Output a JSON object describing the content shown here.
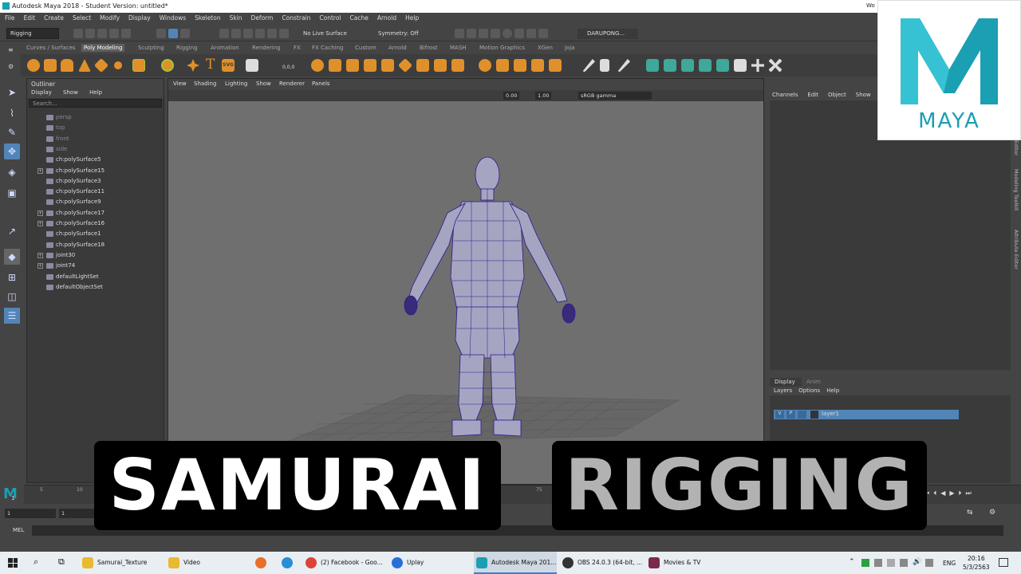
{
  "window": {
    "title": "Autodesk Maya 2018 - Student Version: untitled*",
    "user_short": "Wo"
  },
  "menubar": [
    "File",
    "Edit",
    "Create",
    "Select",
    "Modify",
    "Display",
    "Windows",
    "Skeleton",
    "Skin",
    "Deform",
    "Constrain",
    "Control",
    "Cache",
    "Arnold",
    "Help"
  ],
  "statusline": {
    "menuset": "Rigging",
    "live_surface": "No Live Surface",
    "symmetry": "Symmetry: Off",
    "user": "DARUPONG..."
  },
  "shelf_tabs": [
    "Curves / Surfaces",
    "Poly Modeling",
    "Sculpting",
    "Rigging",
    "Animation",
    "Rendering",
    "FX",
    "FX Caching",
    "Custom",
    "Arnold",
    "Bifrost",
    "MASH",
    "Motion Graphics",
    "XGen",
    "Joja"
  ],
  "shelf_active": "Poly Modeling",
  "shelf_text_icon": "SVG",
  "shelf_extra_label": "0,0,0",
  "outliner": {
    "title": "Outliner",
    "menu": [
      "Display",
      "Show",
      "Help"
    ],
    "search_placeholder": "Search...",
    "items": [
      {
        "label": "persp",
        "dim": true,
        "expand": false
      },
      {
        "label": "top",
        "dim": true,
        "expand": false
      },
      {
        "label": "front",
        "dim": true,
        "expand": false
      },
      {
        "label": "side",
        "dim": true,
        "expand": false
      },
      {
        "label": "ch:polySurface5",
        "dim": false,
        "expand": false
      },
      {
        "label": "ch:polySurface15",
        "dim": false,
        "expand": true
      },
      {
        "label": "ch:polySurface3",
        "dim": false,
        "expand": false
      },
      {
        "label": "ch:polySurface11",
        "dim": false,
        "expand": false
      },
      {
        "label": "ch:polySurface9",
        "dim": false,
        "expand": false
      },
      {
        "label": "ch:polySurface17",
        "dim": false,
        "expand": true
      },
      {
        "label": "ch:polySurface16",
        "dim": false,
        "expand": true
      },
      {
        "label": "ch:polySurface1",
        "dim": false,
        "expand": false
      },
      {
        "label": "ch:polySurface18",
        "dim": false,
        "expand": false
      },
      {
        "label": "joint30",
        "dim": false,
        "expand": true
      },
      {
        "label": "joint74",
        "dim": false,
        "expand": true
      },
      {
        "label": "defaultLightSet",
        "dim": false,
        "expand": false
      },
      {
        "label": "defaultObjectSet",
        "dim": false,
        "expand": false
      }
    ]
  },
  "viewport": {
    "menu": [
      "View",
      "Shading",
      "Lighting",
      "Show",
      "Renderer",
      "Panels"
    ],
    "val1": "0.00",
    "val2": "1.00",
    "colorspace": "sRGB gamma"
  },
  "channelbox": {
    "menu": [
      "Channels",
      "Edit",
      "Object",
      "Show"
    ]
  },
  "layers": {
    "tabs": [
      "Display",
      "Anim"
    ],
    "menu": [
      "Layers",
      "Options",
      "Help"
    ],
    "layer_v": "V",
    "layer_p": "P",
    "layer_name": "layer1"
  },
  "side_tabs": [
    "Editor",
    "Modeling Toolkit",
    "Attribute Editor"
  ],
  "logo": {
    "text": "MAYA",
    "letter": "M"
  },
  "timeslider": {
    "ticks": [
      "1",
      "5",
      "10",
      "75"
    ]
  },
  "range": {
    "start": "1",
    "start2": "1"
  },
  "mel": {
    "label": "MEL"
  },
  "overlay": {
    "word1": "SAMURAI",
    "word2": "RIGGING"
  },
  "taskbar": {
    "items": [
      "Samurai_Texture",
      "Video",
      "(2) Facebook - Goo...",
      "Uplay",
      "Autodesk Maya 201...",
      "OBS 24.0.3 (64-bit, ...",
      "Movies & TV"
    ],
    "lang": "ENG",
    "time": "20:16",
    "date": "5/3/2563"
  },
  "colors": {
    "accent": "#5285b7",
    "maya_teal": "#1a9fb3",
    "wire": "#2a1a8a",
    "mesh": "#9c9cbc"
  }
}
